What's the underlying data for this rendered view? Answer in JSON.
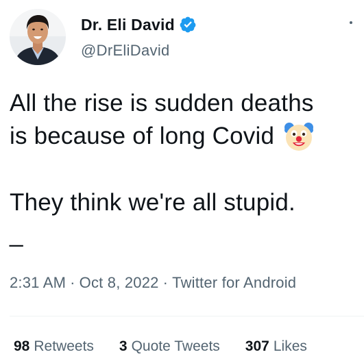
{
  "author": {
    "display_name": "Dr. Eli David",
    "handle": "@DrEliDavid",
    "verified": true
  },
  "tweet": {
    "line1": "All the rise is sudden deaths",
    "line2": "is because of long Covid",
    "emoji": "clown-face",
    "paragraph2": "They think we're all stupid.",
    "dash": "_"
  },
  "meta": {
    "time": "2:31 AM",
    "date": "Oct 8, 2022",
    "source": "Twitter for Android",
    "separator": "·"
  },
  "stats": {
    "retweets_count": "98",
    "retweets_label": "Retweets",
    "quotes_count": "3",
    "quotes_label": "Quote Tweets",
    "likes_count": "307",
    "likes_label": "Likes"
  },
  "colors": {
    "verified_badge": "#1d9bf0",
    "text_primary": "#0f1419",
    "text_secondary": "#536471",
    "divider": "#eff3f4"
  }
}
